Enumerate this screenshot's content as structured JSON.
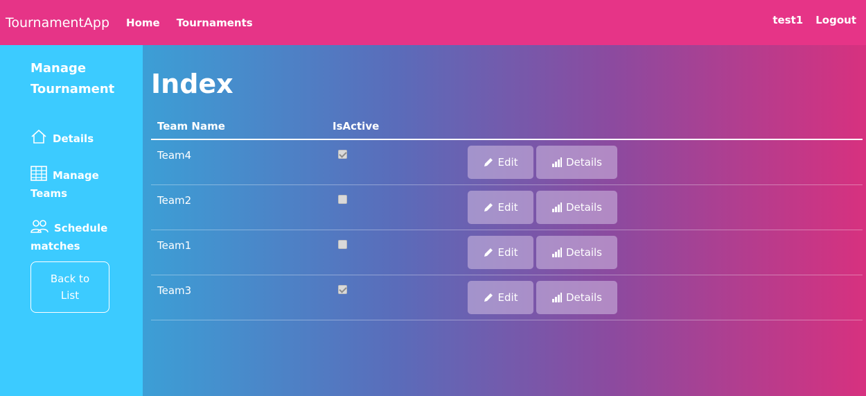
{
  "navbar": {
    "brand": "TournamentApp",
    "links": [
      "Home",
      "Tournaments"
    ],
    "user": "test1",
    "logout": "Logout",
    "color": "#e63487"
  },
  "sidebar": {
    "title": "Manage Tournament",
    "items": [
      {
        "label": "Details",
        "icon": "home-icon"
      },
      {
        "label": "Manage Teams",
        "icon": "table-icon"
      },
      {
        "label": "Schedule matches",
        "icon": "people-icon"
      }
    ],
    "back_button": "Back to List",
    "color": "#3ccbff"
  },
  "main": {
    "title": "Index",
    "columns": [
      "Team Name",
      "IsActive"
    ],
    "rows": [
      {
        "name": "Team4",
        "active": true
      },
      {
        "name": "Team2",
        "active": false
      },
      {
        "name": "Team1",
        "active": false
      },
      {
        "name": "Team3",
        "active": true
      }
    ],
    "edit_label": "Edit",
    "details_label": "Details",
    "edit_icon": "pencil-icon",
    "details_icon": "bar-chart-icon"
  }
}
